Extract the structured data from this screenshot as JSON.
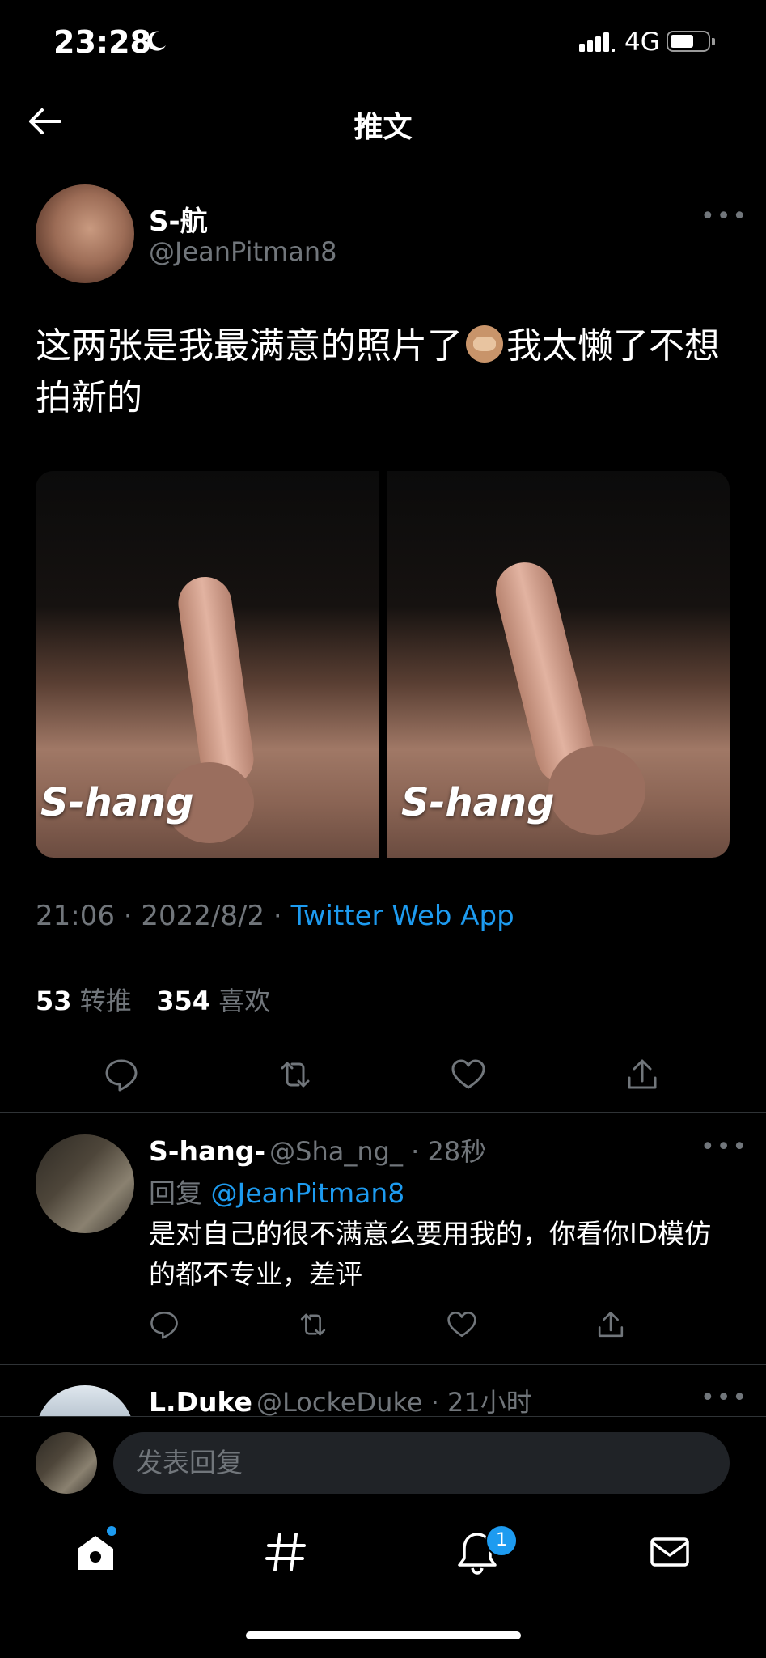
{
  "status_bar": {
    "time": "23:28",
    "network": "4G"
  },
  "header": {
    "title": "推文"
  },
  "tweet": {
    "author_name": "S-航",
    "author_handle": "@JeanPitman8",
    "text_part1": "这两张是我最满意的照片了",
    "text_part2": "我太懒了不想拍新的",
    "media": [
      {
        "watermark": "S-hang"
      },
      {
        "watermark": "S-hang"
      }
    ],
    "time": "21:06",
    "date": "2022/8/2",
    "source": "Twitter Web App",
    "retweets_count": "53",
    "retweets_label": "转推",
    "likes_count": "354",
    "likes_label": "喜欢"
  },
  "replies": [
    {
      "name": "S-hang-",
      "handle": "@Sha_ng_",
      "time": "28秒",
      "reply_to_label": "回复",
      "reply_to": "@JeanPitman8",
      "text": "是对自己的很不满意么要用我的，你看你ID模仿的都不专业，差评"
    },
    {
      "name": "L.Duke",
      "handle": "@LockeDuke",
      "time": "21小时"
    }
  ],
  "composer": {
    "placeholder": "发表回复"
  },
  "tab_bar": {
    "notifications_badge": "1"
  },
  "colors": {
    "background": "#000000",
    "accent": "#1d9bf0",
    "muted": "#71767b",
    "divider": "#2f3336"
  }
}
